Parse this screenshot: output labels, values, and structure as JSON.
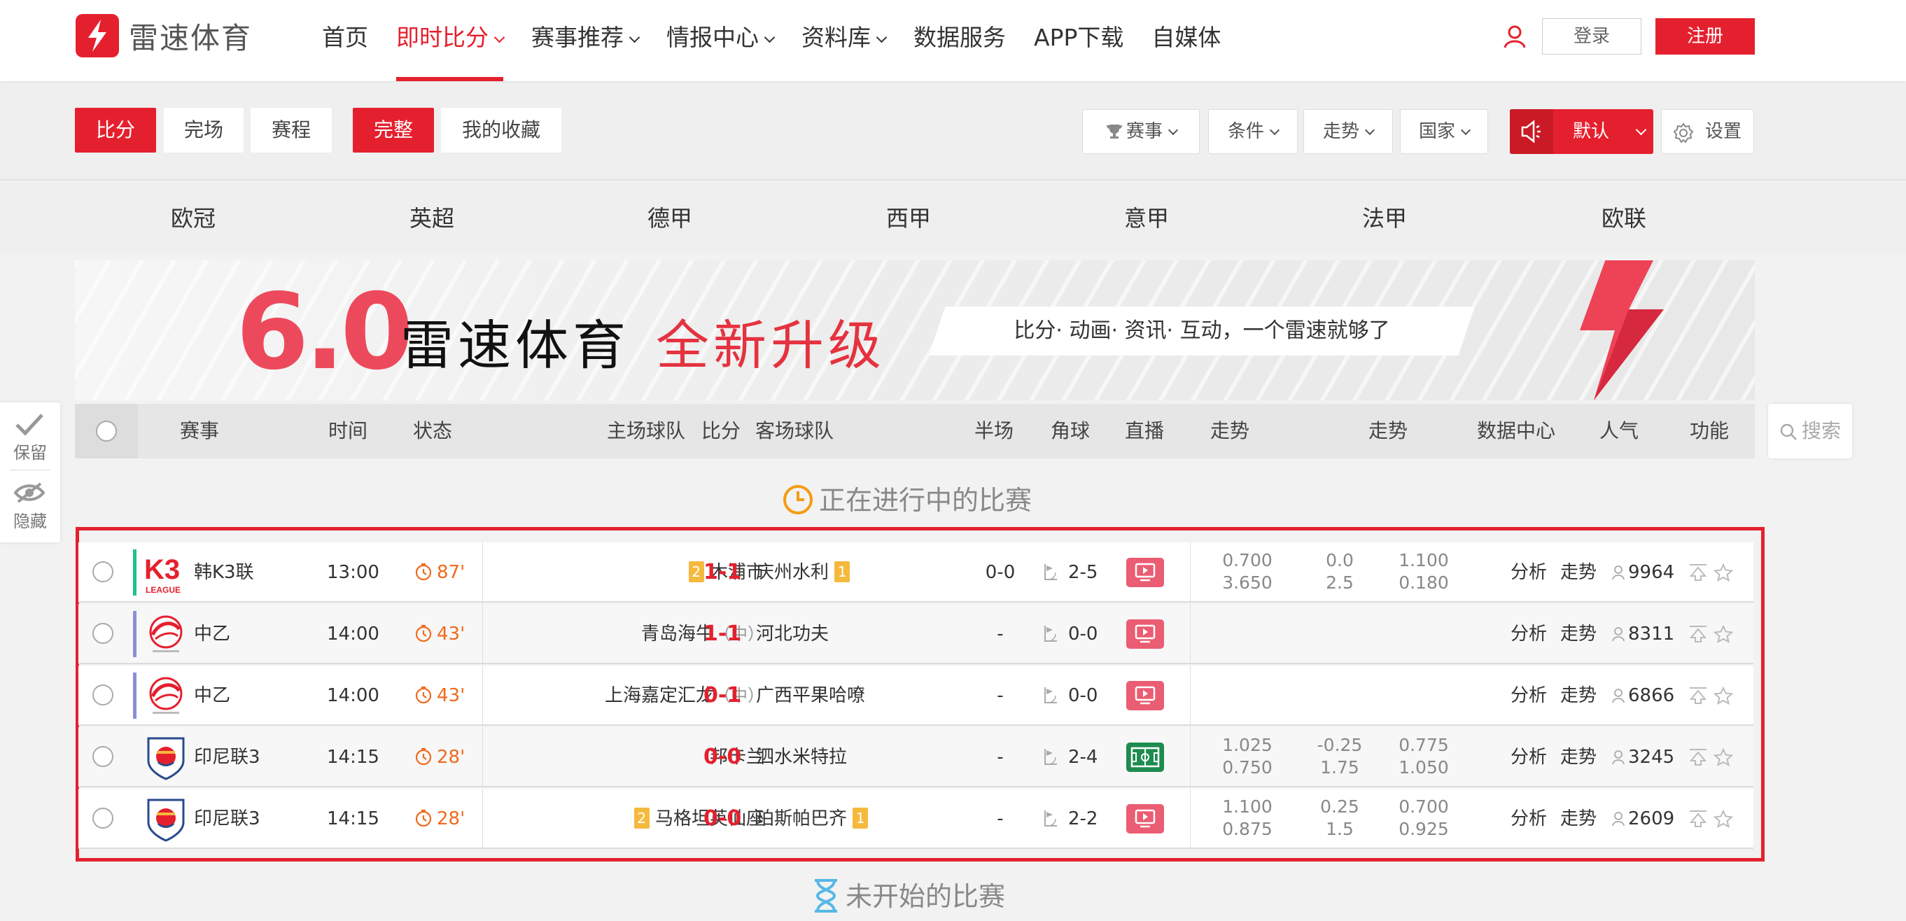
{
  "brand": {
    "name": "雷速体育",
    "color": "#e5202e"
  },
  "nav": {
    "items": [
      {
        "label": "首页",
        "dropdown": false,
        "active": false
      },
      {
        "label": "即时比分",
        "dropdown": true,
        "active": true
      },
      {
        "label": "赛事推荐",
        "dropdown": true,
        "active": false
      },
      {
        "label": "情报中心",
        "dropdown": true,
        "active": false
      },
      {
        "label": "资料库",
        "dropdown": true,
        "active": false
      },
      {
        "label": "数据服务",
        "dropdown": false,
        "active": false
      },
      {
        "label": "APP下载",
        "dropdown": false,
        "active": false
      },
      {
        "label": "自媒体",
        "dropdown": false,
        "active": false
      }
    ],
    "login": "登录",
    "register": "注册",
    "user_icon": "user-icon"
  },
  "toolbar": {
    "tabs": [
      "比分",
      "完场",
      "赛程"
    ],
    "views": [
      "完整",
      "我的收藏"
    ],
    "filters": [
      "赛事",
      "条件",
      "走势",
      "国家"
    ],
    "sound_label": "默认",
    "settings_label": "设置"
  },
  "leagues": [
    "欧冠",
    "英超",
    "德甲",
    "西甲",
    "意甲",
    "法甲",
    "欧联"
  ],
  "banner": {
    "version": "6.0",
    "brand": "雷速体育",
    "slogan": "全新升级",
    "tagline": "比分· 动画· 资讯· 互动，一个雷速就够了"
  },
  "side": {
    "keep": "保留",
    "hide": "隐藏",
    "search": "搜索"
  },
  "table": {
    "headers": {
      "league": "赛事",
      "time": "时间",
      "status": "状态",
      "home": "主场球队",
      "score": "比分",
      "away": "客场球队",
      "half": "半场",
      "corner": "角球",
      "live": "直播",
      "trend1": "走势",
      "trend2": "走势",
      "data": "数据中心",
      "pop": "人气",
      "func": "功能"
    }
  },
  "sections": {
    "live": "正在进行中的比赛",
    "upcoming": "未开始的比赛"
  },
  "matches": [
    {
      "league": "韩K3联",
      "league_color": "#1ec28b",
      "league_logo": "K3",
      "time": "13:00",
      "minute": "87'",
      "home": "木浦市",
      "home_badge": "2",
      "home_tag": "",
      "score": "1-1",
      "away": "庆州水利",
      "away_badge": "1",
      "half": "0-0",
      "corner": "2-5",
      "live_type": "video",
      "odds": [
        "0.700",
        "3.650",
        "0.0",
        "2.5",
        "1.100",
        "0.180"
      ],
      "analyze": "分析",
      "trend": "走势",
      "pop": "9964"
    },
    {
      "league": "中乙",
      "league_color": "#8c8fd6",
      "league_logo": "CN",
      "time": "14:00",
      "minute": "43'",
      "home": "青岛海牛",
      "home_badge": "",
      "home_tag": "（中）",
      "score": "1-1",
      "away": "河北功夫",
      "away_badge": "",
      "half": "-",
      "corner": "0-0",
      "live_type": "video",
      "odds": [],
      "analyze": "分析",
      "trend": "走势",
      "pop": "8311"
    },
    {
      "league": "中乙",
      "league_color": "#8c8fd6",
      "league_logo": "CN",
      "time": "14:00",
      "minute": "43'",
      "home": "上海嘉定汇龙",
      "home_badge": "",
      "home_tag": "（中）",
      "score": "0-1",
      "away": "广西平果哈嘹",
      "away_badge": "",
      "half": "-",
      "corner": "0-0",
      "live_type": "video",
      "odds": [],
      "analyze": "分析",
      "trend": "走势",
      "pop": "6866"
    },
    {
      "league": "印尼联3",
      "league_color": "",
      "league_logo": "ID",
      "time": "14:15",
      "minute": "28'",
      "home": "邦卡兰",
      "home_badge": "",
      "home_tag": "",
      "score": "0-0",
      "away": "泗水米特拉",
      "away_badge": "",
      "half": "-",
      "corner": "2-4",
      "live_type": "field",
      "odds": [
        "1.025",
        "0.750",
        "-0.25",
        "1.75",
        "0.775",
        "1.050"
      ],
      "analyze": "分析",
      "trend": "走势",
      "pop": "3245"
    },
    {
      "league": "印尼联3",
      "league_color": "",
      "league_logo": "ID",
      "time": "14:15",
      "minute": "28'",
      "home": "马格坦英仙座",
      "home_badge": "2",
      "home_tag": "",
      "score": "0-0",
      "away": "珀斯帕巴齐",
      "away_badge": "1",
      "half": "-",
      "corner": "2-2",
      "live_type": "video",
      "odds": [
        "1.100",
        "0.875",
        "0.25",
        "1.5",
        "0.700",
        "0.925"
      ],
      "analyze": "分析",
      "trend": "走势",
      "pop": "2609"
    }
  ]
}
